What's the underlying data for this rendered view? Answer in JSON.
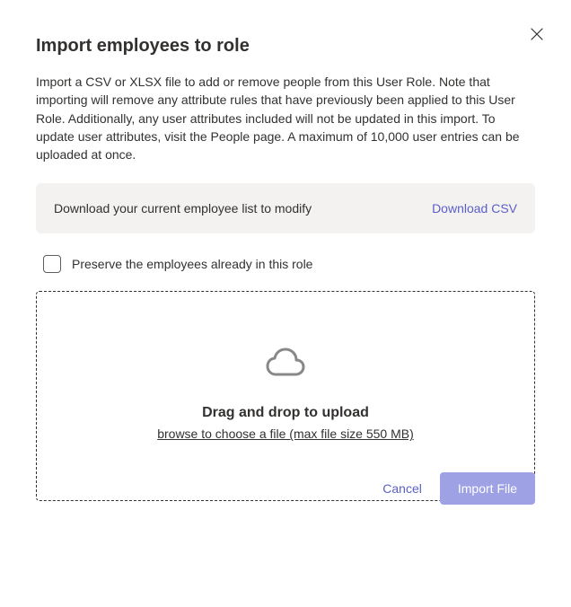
{
  "dialog": {
    "title": "Import employees to role",
    "description": "Import a CSV or XLSX file to add or remove people from this User Role. Note that importing will remove any attribute rules that have previously been applied to this User Role. Additionally, any user attributes included will not be updated in this import. To update user attributes, visit the People page. A maximum of 10,000 user entries can be uploaded at once."
  },
  "download": {
    "text": "Download your current employee list to modify",
    "link": "Download CSV"
  },
  "checkbox": {
    "label": "Preserve the employees already in this role",
    "checked": false
  },
  "dropzone": {
    "title": "Drag and drop to upload",
    "subtitle": "browse to choose a file (max file size 550 MB)"
  },
  "footer": {
    "cancel": "Cancel",
    "import": "Import File"
  }
}
